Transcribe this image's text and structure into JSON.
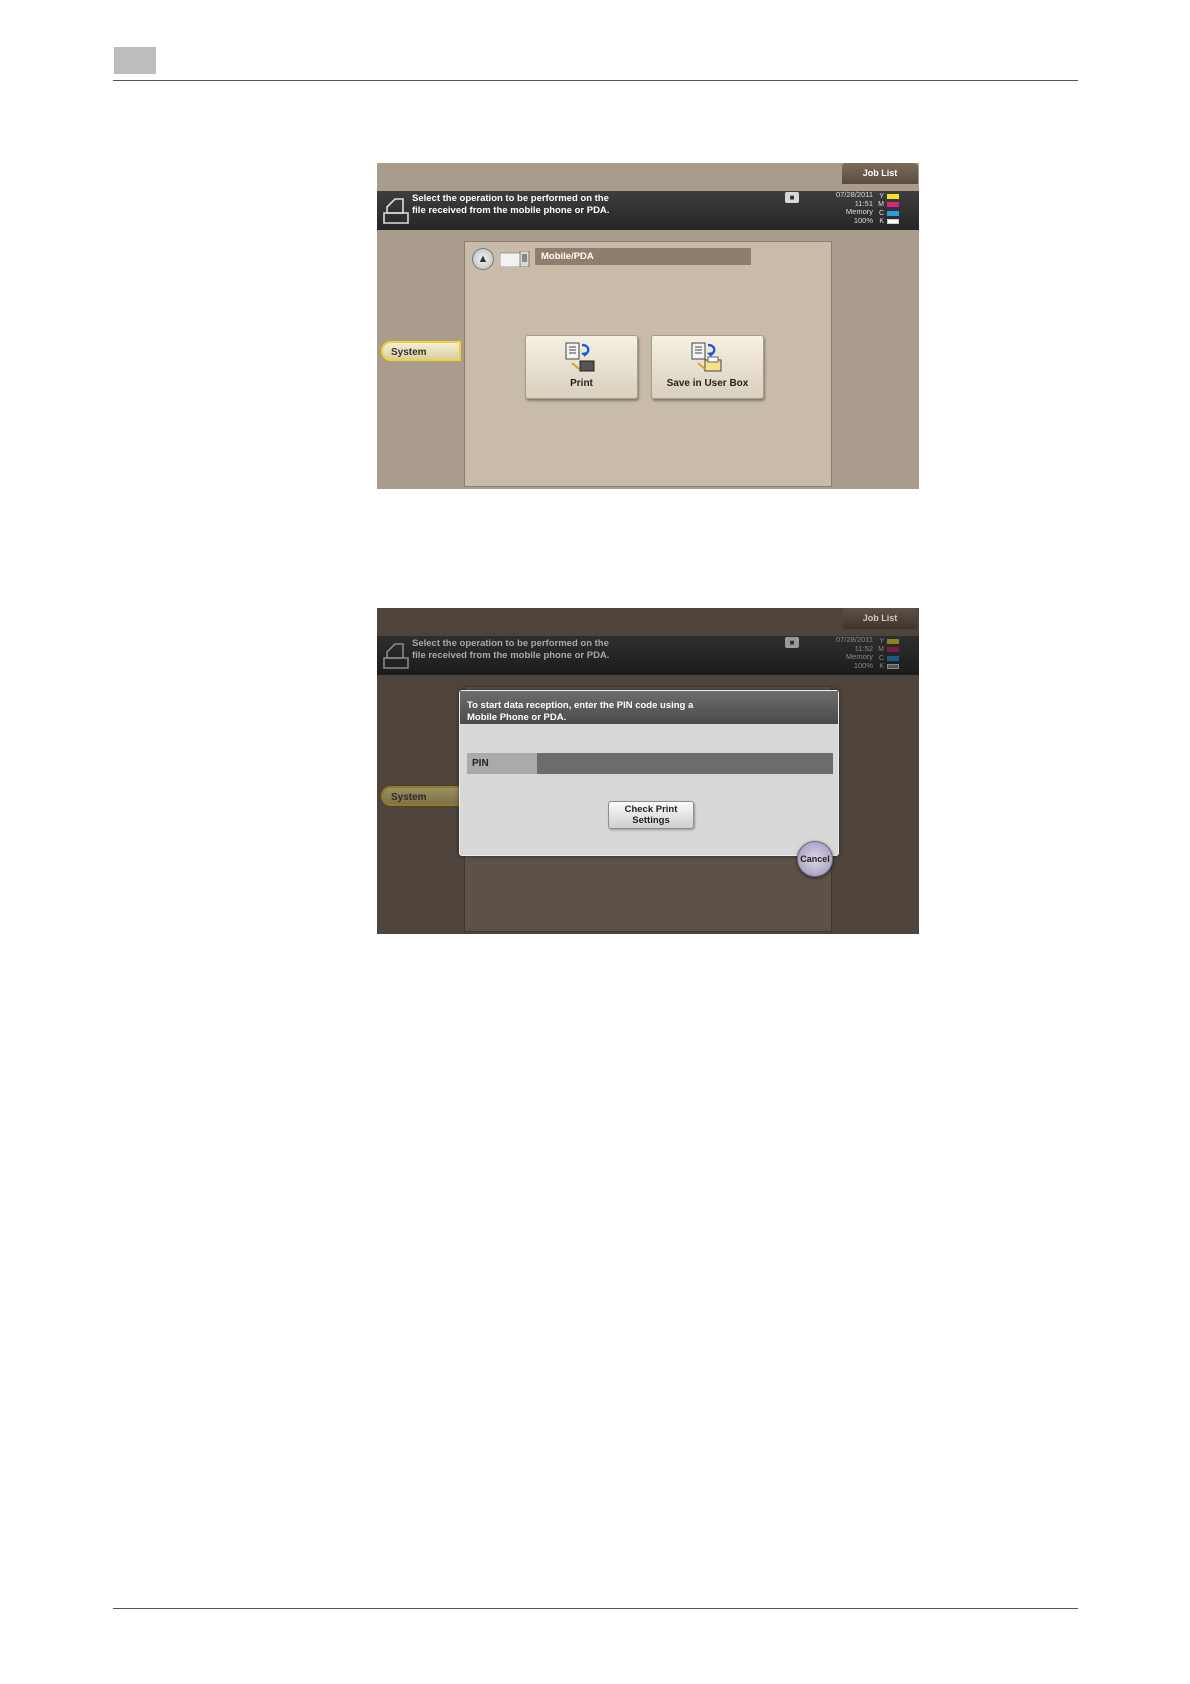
{
  "screen1": {
    "job_list": "Job List",
    "message_line1": "Select the operation to be performed on the",
    "message_line2": "file received from the mobile phone or PDA.",
    "status_date": "07/28/2011",
    "status_time": "11:51",
    "status_memory_label": "Memory",
    "status_memory_value": "100%",
    "system_tab": "System",
    "path_label": "Mobile/PDA",
    "print_label": "Print",
    "save_label": "Save in User Box"
  },
  "screen2": {
    "job_list": "Job List",
    "message_line1": "Select the operation to be performed on the",
    "message_line2": "file received from the mobile phone or PDA.",
    "status_date": "07/28/2011",
    "status_time": "11:52",
    "status_memory_label": "Memory",
    "status_memory_value": "100%",
    "system_tab": "System",
    "dialog_line1": "To start data reception, enter the PIN code using a",
    "dialog_line2": "Mobile Phone or PDA.",
    "pin_label": "PIN",
    "check_line1": "Check Print",
    "check_line2": "Settings",
    "cancel_label": "Cancel"
  },
  "toner": {
    "letters": [
      "Y",
      "M",
      "C",
      "K"
    ],
    "colors": [
      "#f2e22a",
      "#d8247a",
      "#2a9ee0",
      "#ffffff"
    ]
  }
}
